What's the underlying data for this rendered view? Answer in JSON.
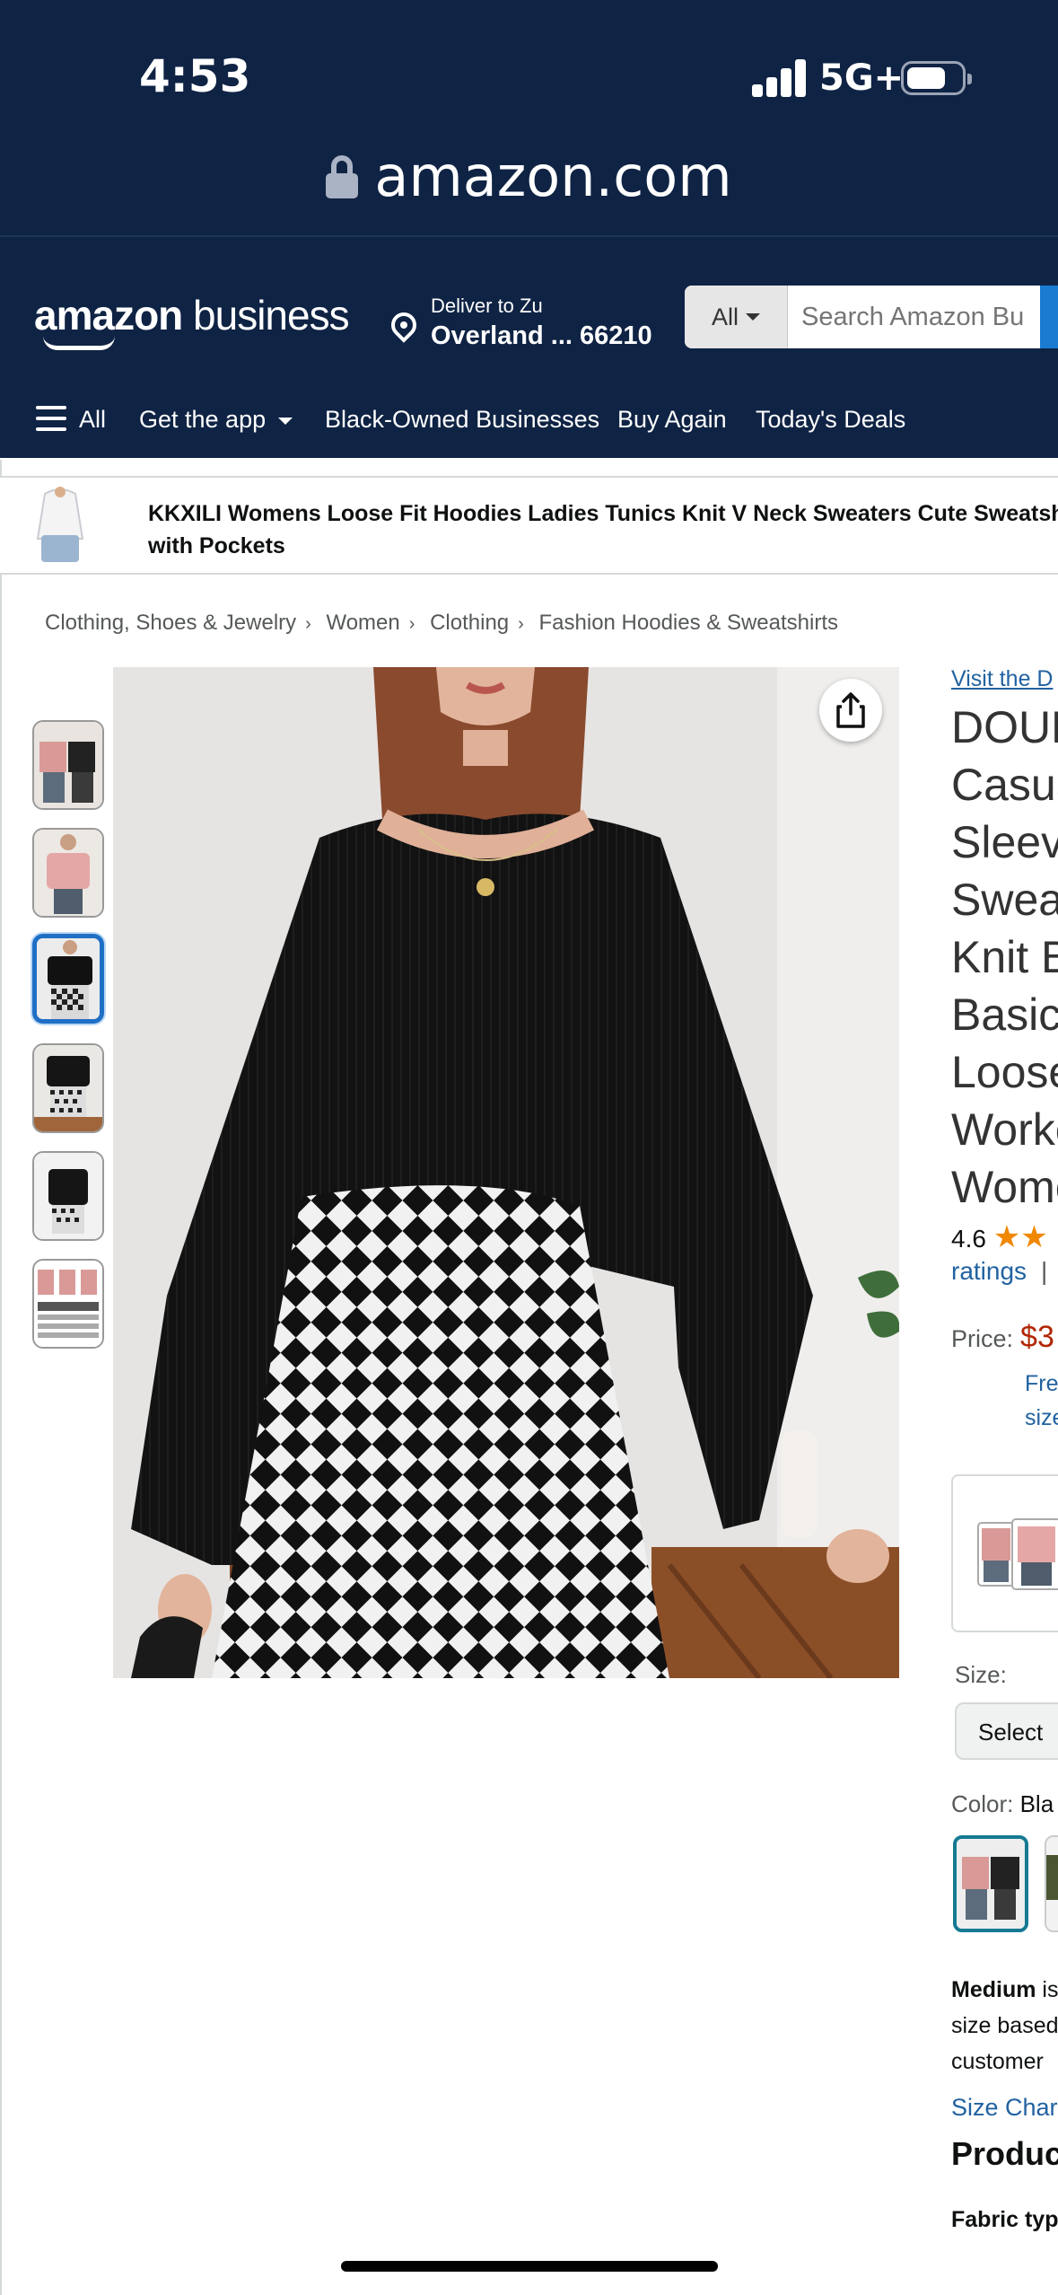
{
  "status_bar": {
    "time": "4:53",
    "network": "5G+"
  },
  "browser": {
    "url": "amazon.com"
  },
  "header": {
    "logo_main": "amazon",
    "logo_sub": "business",
    "deliver_line1": "Deliver to Zu",
    "deliver_line2": "Overland ... 66210",
    "search_category": "All",
    "search_placeholder": "Search Amazon Bu"
  },
  "nav": {
    "all": "All",
    "items": [
      "Get the app",
      "Black-Owned Businesses",
      "Buy Again",
      "Today's Deals"
    ]
  },
  "sticky_product": {
    "title": "KKXILI Womens Loose Fit Hoodies Ladies Tunics Knit V Neck Sweaters Cute Sweatshirts with Pockets"
  },
  "breadcrumb": [
    "Clothing, Shoes & Jewelry",
    "Women",
    "Clothing",
    "Fashion Hoodies & Sweatshirts"
  ],
  "gallery": {
    "thumbnail_count": 6,
    "active_index": 2
  },
  "product": {
    "visit_store": "Visit the D",
    "title_lines": [
      "DOUB",
      "Casua",
      "Sleev",
      "Sweat",
      "Knit B",
      "Basic",
      "Loose",
      "Worke",
      "Wome"
    ],
    "rating_value": "4.6",
    "rating_stars": 4.6,
    "ratings_link": "ratings",
    "ratings_sep": "|",
    "price_label": "Price:",
    "price": "$3",
    "free_line1": "Fre",
    "free_line2": "size",
    "size_label": "Size:",
    "size_select": "Select",
    "color_label": "Color:",
    "color_value": "Bla",
    "fit_bold": "Medium",
    "fit_line1_rest": " is",
    "fit_line2": "size based",
    "fit_line3": "customer",
    "size_chart": "Size Char",
    "details_heading": "Produc",
    "fabric_label": "Fabric typ"
  },
  "colors": {
    "header_bg": "#0f2344",
    "link": "#2162a1",
    "price": "#b12704",
    "star": "#f08804",
    "active_thumb": "#1f6fc5"
  }
}
